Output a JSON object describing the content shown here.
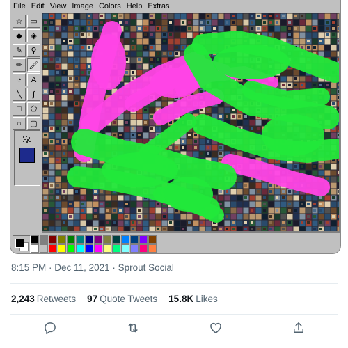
{
  "paint": {
    "menu": [
      "File",
      "Edit",
      "View",
      "Image",
      "Colors",
      "Help",
      "Extras"
    ],
    "tools": [
      {
        "name": "free-select-icon",
        "glyph": "☆"
      },
      {
        "name": "rect-select-icon",
        "glyph": "▭"
      },
      {
        "name": "eraser-icon",
        "glyph": "◆"
      },
      {
        "name": "fill-bucket-icon",
        "glyph": "◈"
      },
      {
        "name": "color-picker-icon",
        "glyph": "✎"
      },
      {
        "name": "magnifier-icon",
        "glyph": "⚲"
      },
      {
        "name": "pencil-icon",
        "glyph": "✏"
      },
      {
        "name": "brush-icon",
        "glyph": "🖌"
      },
      {
        "name": "airbrush-icon",
        "glyph": "◔"
      },
      {
        "name": "text-icon",
        "glyph": "A"
      },
      {
        "name": "line-icon",
        "glyph": "╲"
      },
      {
        "name": "curve-icon",
        "glyph": "∫"
      },
      {
        "name": "rectangle-icon",
        "glyph": "□"
      },
      {
        "name": "polygon-icon",
        "glyph": "⬠"
      },
      {
        "name": "ellipse-icon",
        "glyph": "○"
      },
      {
        "name": "rounded-rect-icon",
        "glyph": "▢"
      }
    ],
    "palette_row1": [
      "#000000",
      "#808080",
      "#800000",
      "#808000",
      "#008000",
      "#008080",
      "#000080",
      "#800080",
      "#808040",
      "#004040",
      "#0080ff",
      "#004080",
      "#8000ff",
      "#804000"
    ],
    "palette_row2": [
      "#ffffff",
      "#c0c0c0",
      "#ff0000",
      "#ffff00",
      "#00ff00",
      "#00ffff",
      "#0000ff",
      "#ff00ff",
      "#ffff80",
      "#00ff80",
      "#80ffff",
      "#8080ff",
      "#ff0080",
      "#ff8040"
    ],
    "paint_colors": {
      "magenta": "#ff44e6",
      "green": "#22e83a"
    }
  },
  "tweet": {
    "time": "8:15 PM",
    "date": "Dec 11, 2021",
    "source": "Sprout Social",
    "retweets_count": "2,243",
    "retweets_label": "Retweets",
    "quotes_count": "97",
    "quotes_label": "Quote Tweets",
    "likes_count": "15.8K",
    "likes_label": "Likes"
  }
}
